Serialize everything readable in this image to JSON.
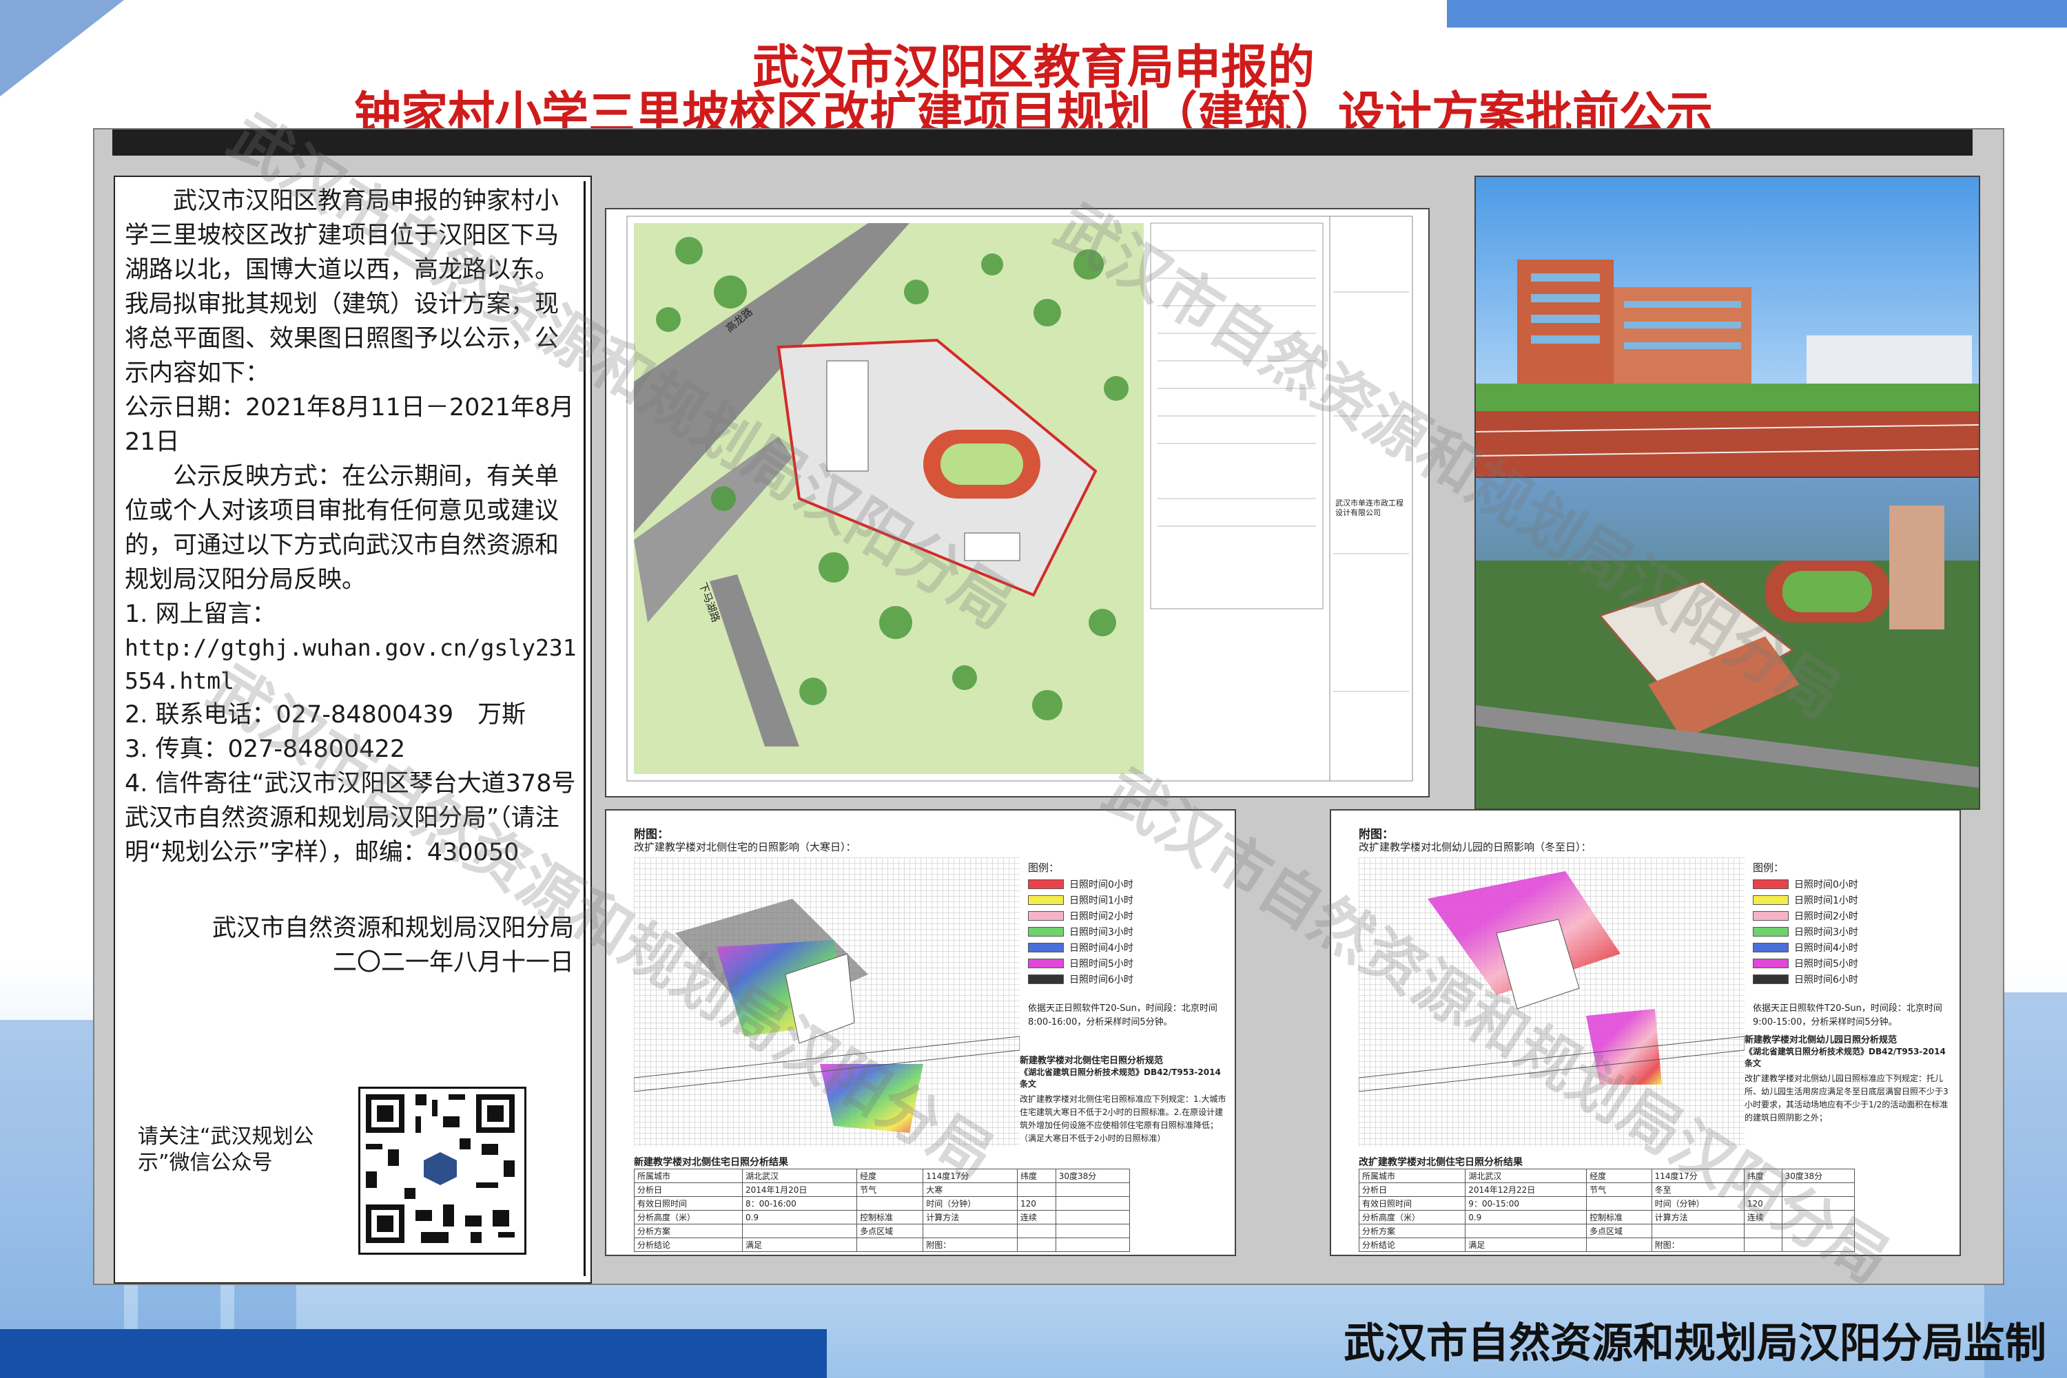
{
  "header": {
    "title_line1": "武汉市汉阳区教育局申报的",
    "title_line2": "钟家村小学三里坡校区改扩建项目规划（建筑）设计方案批前公示"
  },
  "notice": {
    "intro": "武汉市汉阳区教育局申报的钟家村小学三里坡校区改扩建项目位于汉阳区下马湖路以北，国博大道以西，高龙路以东。我局拟审批其规划（建筑）设计方案，现将总平面图、效果图日照图予以公示，公示内容如下：",
    "date": "公示日期：2021年8月11日－2021年8月21日",
    "feedback": "公示反映方式：在公示期间，有关单位或个人对该项目审批有任何意见或建议的，可通过以下方式向武汉市自然资源和规划局汉阳分局反映。",
    "item1_label": "1. 网上留言：",
    "item1_url": "http://gtghj.wuhan.gov.cn/gsly231554.html",
    "item2": "2. 联系电话：027-84800439　万斯",
    "item3": "3. 传真：027-84800422",
    "item4": "4. 信件寄往“武汉市汉阳区琴台大道378号　武汉市自然资源和规划局汉阳分局”（请注明“规划公示”字样），邮编：430050",
    "signature_org": "武汉市自然资源和规划局汉阳分局",
    "signature_date": "二〇二一年八月十一日",
    "qr_caption": "请关注“武汉规划公示”微信公众号"
  },
  "site_plan": {
    "road_label_1": "高龙路",
    "road_label_2": "下马湖路",
    "designer": "武汉市单连市政工程设计有限公司"
  },
  "sunlight_left": {
    "heading": "附图：",
    "subtitle": "改扩建教学楼对北侧住宅的日照影响（大寒日）：",
    "legend_title": "图例：",
    "legend": [
      "日照时间0小时",
      "日照时间1小时",
      "日照时间2小时",
      "日照时间3小时",
      "日照时间4小时",
      "日照时间5小时",
      "日照时间6小时"
    ],
    "legend_colors": [
      "#e8434a",
      "#f4ec4a",
      "#f7b3c6",
      "#6fd36b",
      "#4b6fd8",
      "#e048d8",
      "#333333"
    ],
    "method": "依据天正日照软件T20-Sun，时间段：北京时间8:00-16:00，分析采样时间5分钟。",
    "rule_title": "新建教学楼对北侧住宅日照分析规范",
    "rule_doc": "《湖北省建筑日照分析技术规范》DB42/T953-2014条文",
    "rule_text": "改扩建教学楼对北侧住宅日照标准应下列规定：1.大城市住宅建筑大寒日不低于2小时的日照标准。2.在原设计建筑外增加任何设施不应使相邻住宅原有日照标准降低；（满足大寒日不低于2小时的日照标准）",
    "table_title": "新建教学楼对北侧住宅日照分析结果",
    "rows": [
      [
        "所属城市",
        "湖北武汉",
        "经度",
        "114度17分",
        "纬度",
        "30度38分"
      ],
      [
        "分析日",
        "2014年1月20日",
        "节气",
        "大寒",
        "",
        ""
      ],
      [
        "有效日照时间",
        "8：00-16:00",
        "",
        "时间（分钟）",
        "120",
        ""
      ],
      [
        "分析高度（米）",
        "0.9",
        "控制标准",
        "计算方法",
        "连续",
        ""
      ],
      [
        "分析方案",
        "",
        "多点区域",
        "",
        "",
        ""
      ],
      [
        "分析结论",
        "满足",
        "",
        "附图：",
        "",
        ""
      ]
    ]
  },
  "sunlight_right": {
    "heading": "附图：",
    "subtitle": "改扩建教学楼对北侧幼儿园的日照影响（冬至日）：",
    "legend_title": "图例：",
    "legend": [
      "日照时间0小时",
      "日照时间1小时",
      "日照时间2小时",
      "日照时间3小时",
      "日照时间4小时",
      "日照时间5小时",
      "日照时间6小时"
    ],
    "legend_colors": [
      "#e8434a",
      "#f4ec4a",
      "#f7b3c6",
      "#6fd36b",
      "#4b6fd8",
      "#e048d8",
      "#333333"
    ],
    "method": "依据天正日照软件T20-Sun，时间段：北京时间9:00-15:00，分析采样时间5分钟。",
    "rule_title": "新建教学楼对北侧幼儿园日照分析规范",
    "rule_doc": "《湖北省建筑日照分析技术规范》DB42/T953-2014条文",
    "rule_text": "改扩建教学楼对北侧幼儿园日照标准应下列规定：托儿所、幼儿园生活用房应满足冬至日底层满窗日照不少于3小时要求，其活动场地应有不少于1/2的活动面积在标准的建筑日照阴影之外；",
    "table_title": "改扩建教学楼对北侧住宅日照分析结果",
    "rows": [
      [
        "所属城市",
        "湖北武汉",
        "经度",
        "114度17分",
        "纬度",
        "30度38分"
      ],
      [
        "分析日",
        "2014年12月22日",
        "节气",
        "冬至",
        "",
        ""
      ],
      [
        "有效日照时间",
        "9：00-15:00",
        "",
        "时间（分钟）",
        "120",
        ""
      ],
      [
        "分析高度（米）",
        "0.9",
        "控制标准",
        "计算方法",
        "连续",
        ""
      ],
      [
        "分析方案",
        "",
        "多点区域",
        "",
        "",
        ""
      ],
      [
        "分析结论",
        "满足",
        "",
        "附图：",
        "",
        ""
      ]
    ]
  },
  "footer": {
    "supervisor": "武汉市自然资源和规划局汉阳分局监制"
  },
  "watermark": {
    "text": "武汉市自然资源和规划局汉阳分局"
  }
}
